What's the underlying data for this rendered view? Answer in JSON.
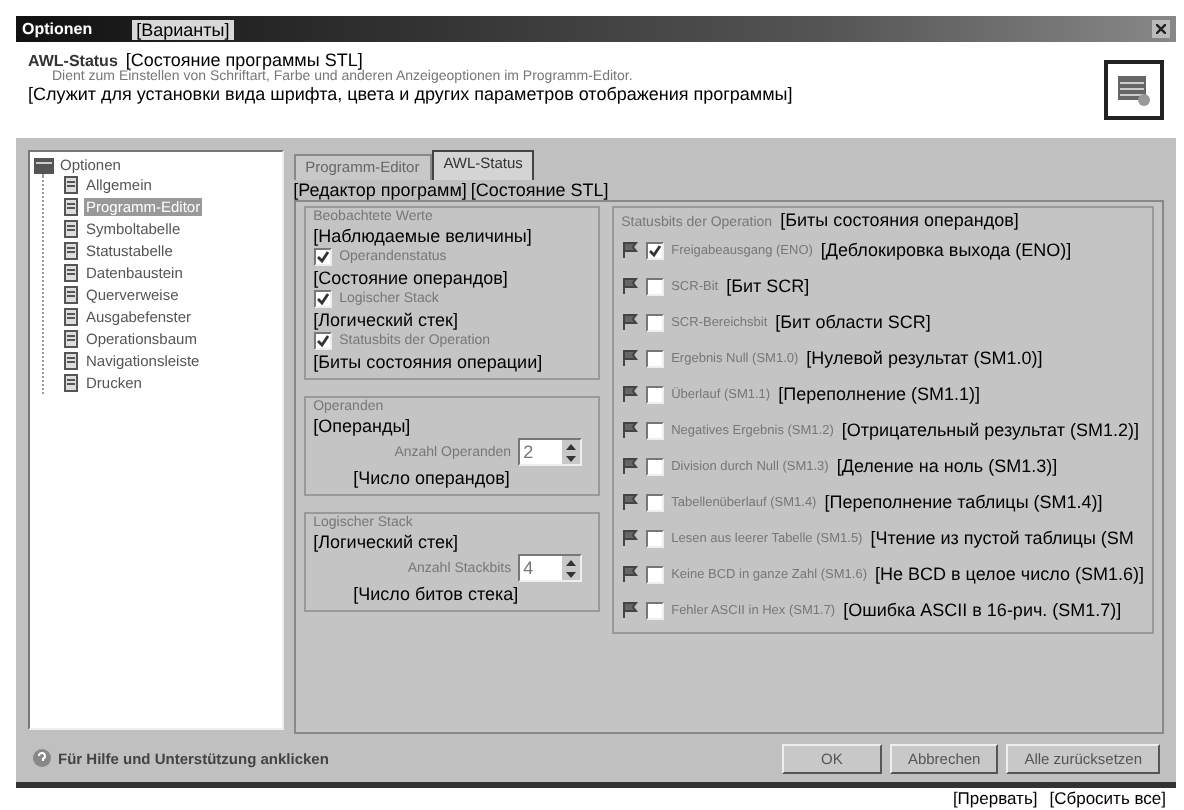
{
  "window": {
    "title": "Optionen",
    "title_note": "[Варианты]"
  },
  "header": {
    "title": "AWL-Status",
    "title_note": "[Состояние программы STL]",
    "description": "Dient zum Einstellen von Schriftart, Farbe und anderen Anzeigeoptionen im Programm-Editor.",
    "description_note": "[Служит для установки вида шрифта, цвета и других параметров отображения программы]"
  },
  "tree": {
    "label": "Optionen",
    "expanded": true,
    "children": [
      {
        "label": "Allgemein",
        "selected": false
      },
      {
        "label": "Programm-Editor",
        "selected": true
      },
      {
        "label": "Symboltabelle",
        "selected": false
      },
      {
        "label": "Statustabelle",
        "selected": false
      },
      {
        "label": "Datenbaustein",
        "selected": false
      },
      {
        "label": "Querverweise",
        "selected": false
      },
      {
        "label": "Ausgabefenster",
        "selected": false
      },
      {
        "label": "Operationsbaum",
        "selected": false
      },
      {
        "label": "Navigationsleiste",
        "selected": false
      },
      {
        "label": "Drucken",
        "selected": false
      }
    ]
  },
  "tabs": [
    {
      "label": "Programm-Editor",
      "selected": false,
      "note": "[Редактор программ]"
    },
    {
      "label": "AWL-Status",
      "selected": true,
      "note": "[Состояние STL]"
    }
  ],
  "watched_values": {
    "title": "Beobachtete Werte",
    "note": "[Наблюдаемые величины]",
    "options": [
      {
        "label": "Operandenstatus",
        "checked": true,
        "note": "[Состояние операндов]"
      },
      {
        "label": "Logischer Stack",
        "checked": true,
        "note": "[Логический стек]"
      },
      {
        "label": "Statusbits der Operation",
        "checked": true,
        "note": "[Биты состояния операции]"
      }
    ]
  },
  "operands": {
    "title": "Operanden",
    "note": "[Операнды]",
    "field_label": "Anzahl Operanden",
    "value": "2",
    "field_note": "[Число операндов]"
  },
  "logic_stack": {
    "title": "Logischer Stack",
    "note": "[Логический стек]",
    "field_label": "Anzahl Stackbits",
    "value": "4",
    "field_note": "[Число битов стека]"
  },
  "status_bits": {
    "title": "Statusbits der Operation",
    "note": "[Биты состояния операндов]",
    "items": [
      {
        "label": "Freigabeausgang (ENO)",
        "checked": true,
        "note": "[Деблокировка выхода (ENO)]"
      },
      {
        "label": "SCR-Bit",
        "checked": false,
        "note": "[Бит SCR]"
      },
      {
        "label": "SCR-Bereichsbit",
        "checked": false,
        "note": "[Бит области SCR]"
      },
      {
        "label": "Ergebnis Null (SM1.0)",
        "checked": false,
        "note": "[Нулевой результат (SM1.0)]"
      },
      {
        "label": "Überlauf (SM1.1)",
        "checked": false,
        "note": "[Переполнение (SM1.1)]"
      },
      {
        "label": "Negatives Ergebnis (SM1.2)",
        "checked": false,
        "note": "[Отрицательный результат (SM1.2)]"
      },
      {
        "label": "Division durch Null (SM1.3)",
        "checked": false,
        "note": "[Деление на ноль (SM1.3)]"
      },
      {
        "label": "Tabellenüberlauf (SM1.4)",
        "checked": false,
        "note": "[Переполнение таблицы (SM1.4)]"
      },
      {
        "label": "Lesen aus leerer Tabelle (SM1.5)",
        "checked": false,
        "note": "[Чтение из пустой таблицы (SM"
      },
      {
        "label": "Keine BCD in ganze Zahl (SM1.6)",
        "checked": false,
        "note": "[Не BCD в целое число (SM1.6)]"
      },
      {
        "label": "Fehler ASCII in Hex (SM1.7)",
        "checked": false,
        "note": "[Ошибка ASCII в 16-рич. (SM1.7)]"
      }
    ]
  },
  "footer": {
    "help_text": "Für Hilfe und Unterstützung anklicken"
  },
  "buttons": [
    {
      "label": "OK"
    },
    {
      "label": "Abbrechen",
      "note": "[Прервать]"
    },
    {
      "label": "Alle zurücksetzen",
      "note": "[Сбросить все]"
    }
  ]
}
